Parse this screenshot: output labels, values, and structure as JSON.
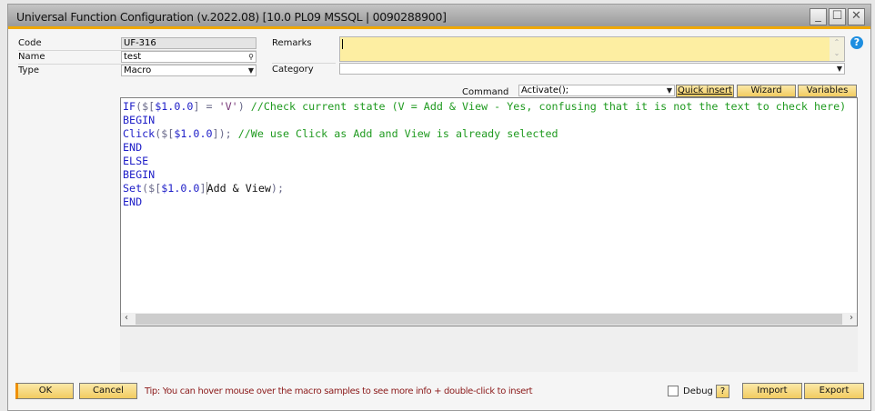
{
  "window": {
    "title": "Universal Function Configuration (v.2022.08) [10.0 PL09 MSSQL | 0090288900]",
    "minimize": "_",
    "maximize": "☐",
    "close": "✕"
  },
  "form": {
    "code_label": "Code",
    "code_value": "UF-316",
    "name_label": "Name",
    "name_value": "test",
    "type_label": "Type",
    "type_value": "Macro",
    "remarks_label": "Remarks",
    "remarks_value": "",
    "category_label": "Category",
    "category_value": "",
    "command_label": "Command",
    "command_value": "Activate();"
  },
  "toolbar": {
    "quick_insert": "Quick insert",
    "wizard": "Wizard",
    "variables": "Variables"
  },
  "code_lines": [
    [
      {
        "t": "IF",
        "k": "kw"
      },
      {
        "t": "($[",
        "k": "pu"
      },
      {
        "t": "$1.0.0",
        "k": "kw"
      },
      {
        "t": "] = ",
        "k": "pu"
      },
      {
        "t": "'V'",
        "k": "st"
      },
      {
        "t": ") ",
        "k": "pu"
      },
      {
        "t": "//Check current state (V = Add & View - Yes, confusing that it is not the text to check here)",
        "k": "cm"
      }
    ],
    [
      {
        "t": "BEGIN",
        "k": "kw"
      }
    ],
    [
      {
        "t": "Click",
        "k": "kw"
      },
      {
        "t": "($[",
        "k": "pu"
      },
      {
        "t": "$1.0.0",
        "k": "kw"
      },
      {
        "t": "]); ",
        "k": "pu"
      },
      {
        "t": "//We use Click as Add and View is already selected",
        "k": "cm"
      }
    ],
    [
      {
        "t": "END",
        "k": "kw"
      }
    ],
    [
      {
        "t": "ELSE",
        "k": "kw"
      }
    ],
    [
      {
        "t": "BEGIN",
        "k": "kw"
      }
    ],
    [
      {
        "t": "Set",
        "k": "kw"
      },
      {
        "t": "($[",
        "k": "pu"
      },
      {
        "t": "$1.0.0",
        "k": "kw"
      },
      {
        "t": "]",
        "k": "pu"
      },
      {
        "t": "|",
        "k": "pu"
      },
      {
        "t": "Add & View",
        "k": "tx"
      },
      {
        "t": ");",
        "k": "pu"
      }
    ],
    [
      {
        "t": "END",
        "k": "kw"
      }
    ]
  ],
  "footer": {
    "ok": "OK",
    "cancel": "Cancel",
    "tip": "Tip: You can hover mouse over the macro samples to see more info + double-click to insert",
    "debug_label": "Debug",
    "debug_checked": false,
    "help": "?",
    "import": "Import",
    "export": "Export"
  },
  "colors": {
    "accent": "#f0a800",
    "button": "#f2cc60",
    "remarks_bg": "#fdeea2",
    "tip": "#8b1a1a"
  }
}
